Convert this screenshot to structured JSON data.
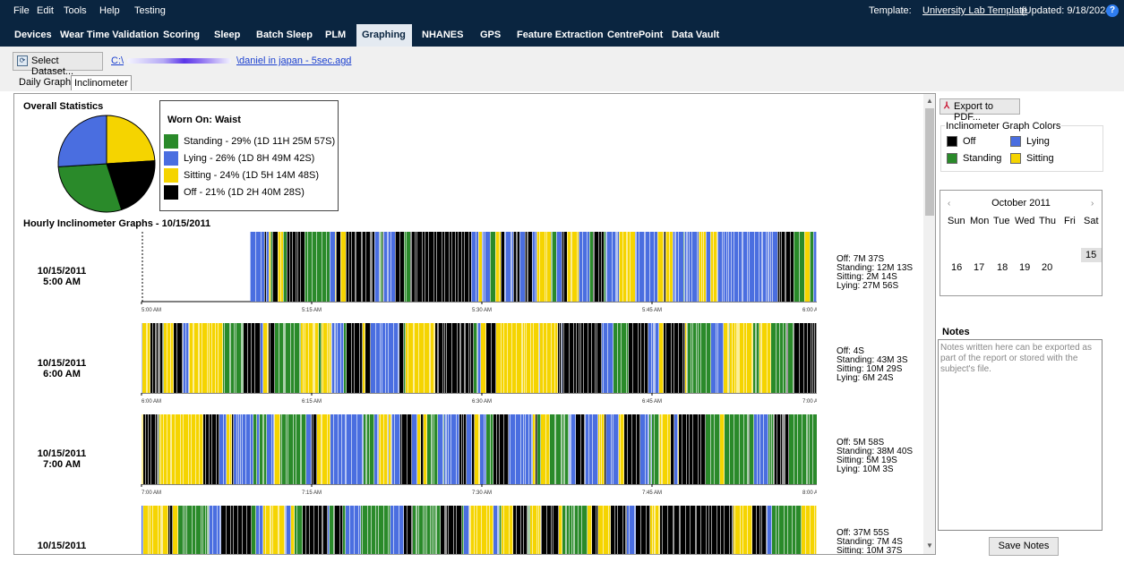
{
  "menu": {
    "file": "File",
    "edit": "Edit",
    "tools": "Tools",
    "help": "Help",
    "testing": "Testing"
  },
  "template": {
    "label": "Template:",
    "name": "University Lab Template",
    "updated": "(Updated: 9/18/2024)"
  },
  "tabs": [
    "Devices",
    "Wear Time Validation",
    "Scoring",
    "Sleep",
    "Batch Sleep",
    "PLM",
    "Graphing",
    "NHANES",
    "GPS",
    "Feature Extraction",
    "CentrePoint",
    "Data Vault"
  ],
  "active_tab": "Graphing",
  "dataset": {
    "button_label": "Select Dataset...",
    "path_prefix": "C:\\",
    "path_file": "\\daniel in japan - 5sec.agd"
  },
  "subtabs": [
    "Daily Graphs",
    "Inclinometer"
  ],
  "active_subtab": "Inclinometer",
  "overall": {
    "title": "Overall Statistics",
    "worn_on": "Worn On: Waist",
    "legend": [
      {
        "label": "Standing - 29% (1D 11H 25M 57S)",
        "color": "#2a8a2a",
        "fraction": 0.29
      },
      {
        "label": "Lying - 26% (1D 8H 49M 42S)",
        "color": "#4a6ee0",
        "fraction": 0.26
      },
      {
        "label": "Sitting - 24% (1D 5H 14M 48S)",
        "color": "#f5d400",
        "fraction": 0.24
      },
      {
        "label": "Off - 21% (1D 2H 40M 28S)",
        "color": "#000000",
        "fraction": 0.21
      }
    ]
  },
  "hourly_title": "Hourly Inclinometer Graphs - 10/15/2011",
  "hours": [
    {
      "date": "10/15/2011",
      "time": "5:00 AM",
      "ticks": [
        "5:00 AM",
        "5:15 AM",
        "5:30 AM",
        "5:45 AM",
        "6:00 AM"
      ],
      "summary": [
        "Off: 7M 37S",
        "Standing: 12M 13S",
        "Sitting: 2M 14S",
        "Lying: 27M 56S"
      ],
      "data_start": 0.16
    },
    {
      "date": "10/15/2011",
      "time": "6:00 AM",
      "ticks": [
        "6:00 AM",
        "6:15 AM",
        "6:30 AM",
        "6:45 AM",
        "7:00 AM"
      ],
      "summary": [
        "Off: 4S",
        "Standing: 43M 3S",
        "Sitting: 10M 29S",
        "Lying: 6M 24S"
      ],
      "data_start": 0
    },
    {
      "date": "10/15/2011",
      "time": "7:00 AM",
      "ticks": [
        "7:00 AM",
        "7:15 AM",
        "7:30 AM",
        "7:45 AM",
        "8:00 AM"
      ],
      "summary": [
        "Off: 5M 58S",
        "Standing: 38M 40S",
        "Sitting: 5M 19S",
        "Lying: 10M 3S"
      ],
      "data_start": 0
    },
    {
      "date": "10/15/2011",
      "time": "",
      "ticks": [],
      "summary": [
        "Off: 37M 55S",
        "Standing: 7M 4S",
        "Sitting: 10M 37S"
      ],
      "data_start": 0
    }
  ],
  "export_label": "Export to PDF...",
  "graph_colors": {
    "title": "Inclinometer Graph Colors",
    "items": [
      {
        "label": "Off",
        "color": "#000000"
      },
      {
        "label": "Lying",
        "color": "#4a6ee0"
      },
      {
        "label": "Standing",
        "color": "#2a8a2a"
      },
      {
        "label": "Sitting",
        "color": "#f5d400"
      }
    ]
  },
  "calendar": {
    "title": "October 2011",
    "dow": [
      "Sun",
      "Mon",
      "Tue",
      "Wed",
      "Thu",
      "Fri",
      "Sat"
    ],
    "days": [
      "15",
      "16",
      "17",
      "18",
      "19",
      "20"
    ],
    "selected": "15"
  },
  "notes": {
    "label": "Notes",
    "placeholder": "Notes written here can be exported as part of the report or stored with the subject's file.",
    "save_label": "Save Notes"
  }
}
